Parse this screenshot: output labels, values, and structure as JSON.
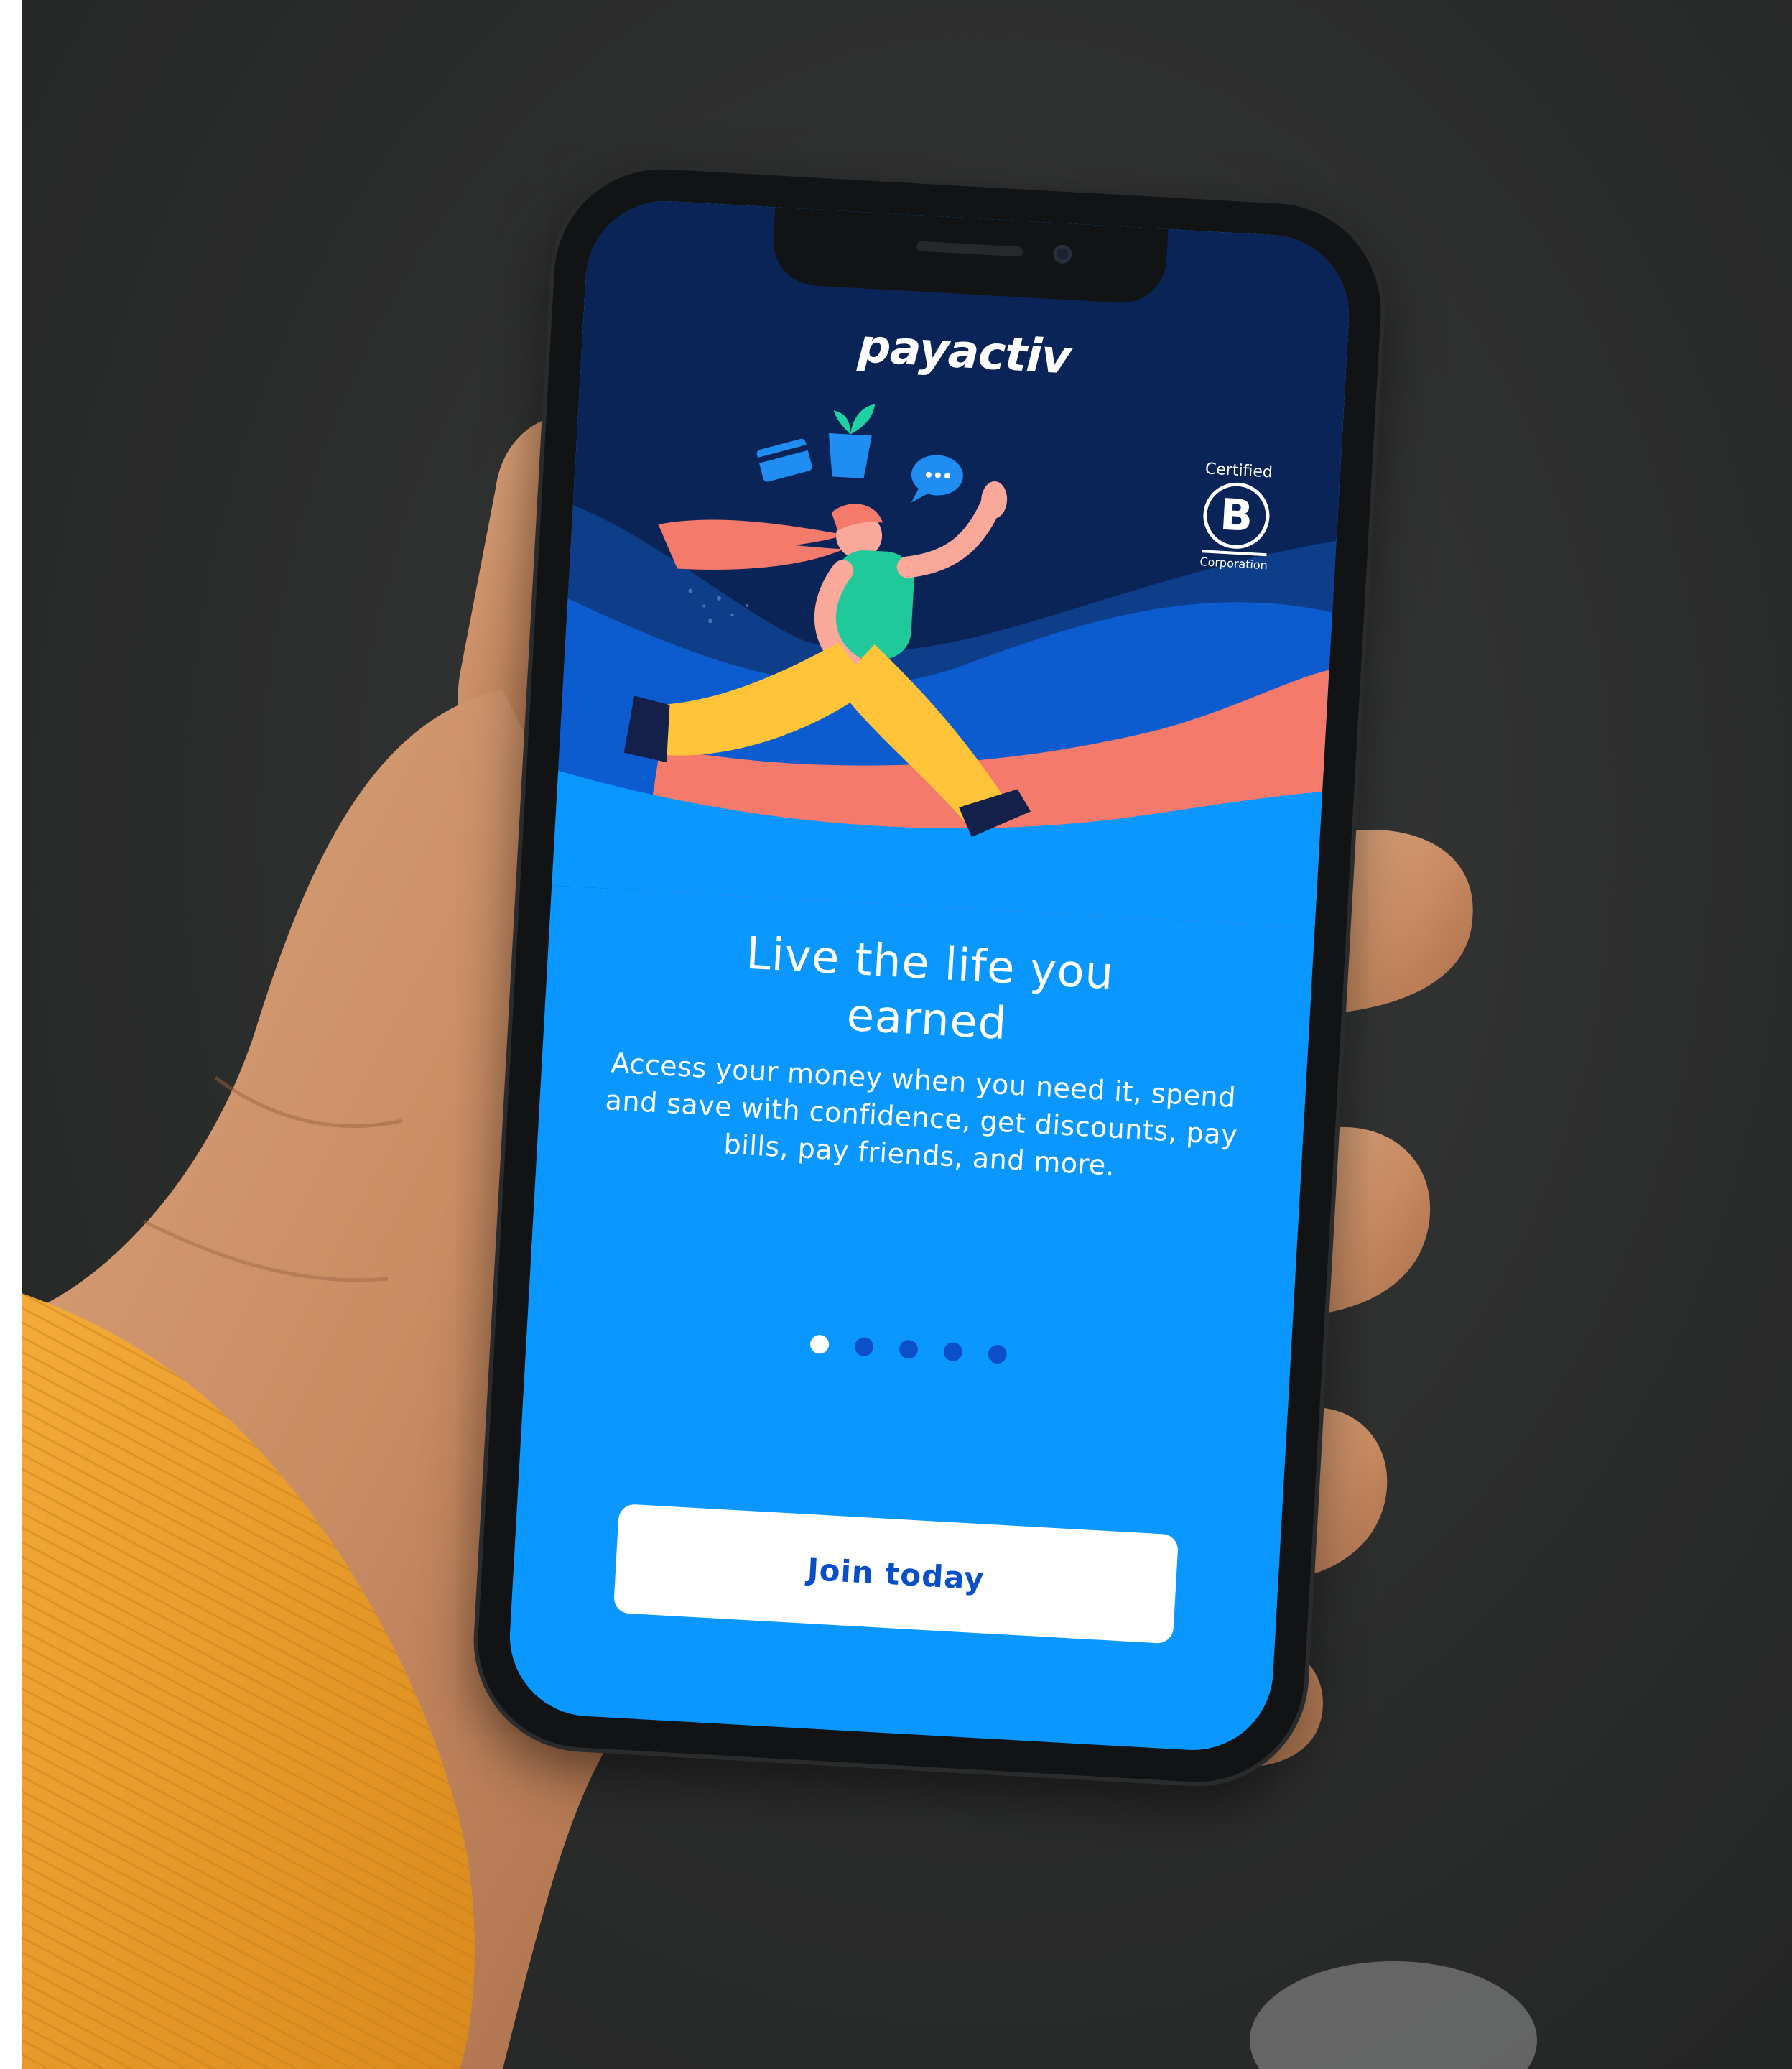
{
  "app": {
    "brand": "payactiv",
    "certification": {
      "top": "Certified",
      "letter": "B",
      "bottom": "Corporation"
    }
  },
  "onboarding": {
    "headline": "Live the life you earned",
    "body": "Access your money when you need it, spend and save with confidence, get discounts, pay bills, pay friends, and more.",
    "pages": 5,
    "current_page": 1,
    "join_label": "Join today"
  },
  "colors": {
    "screen_blue": "#0a97ff",
    "navy": "#0b2457",
    "button_text": "#0a4fc8",
    "coral": "#f47a6c",
    "sweater": "#f0a02a"
  },
  "icons": [
    "credit-card-icon",
    "potted-plant-icon",
    "chat-bubble-icon"
  ]
}
